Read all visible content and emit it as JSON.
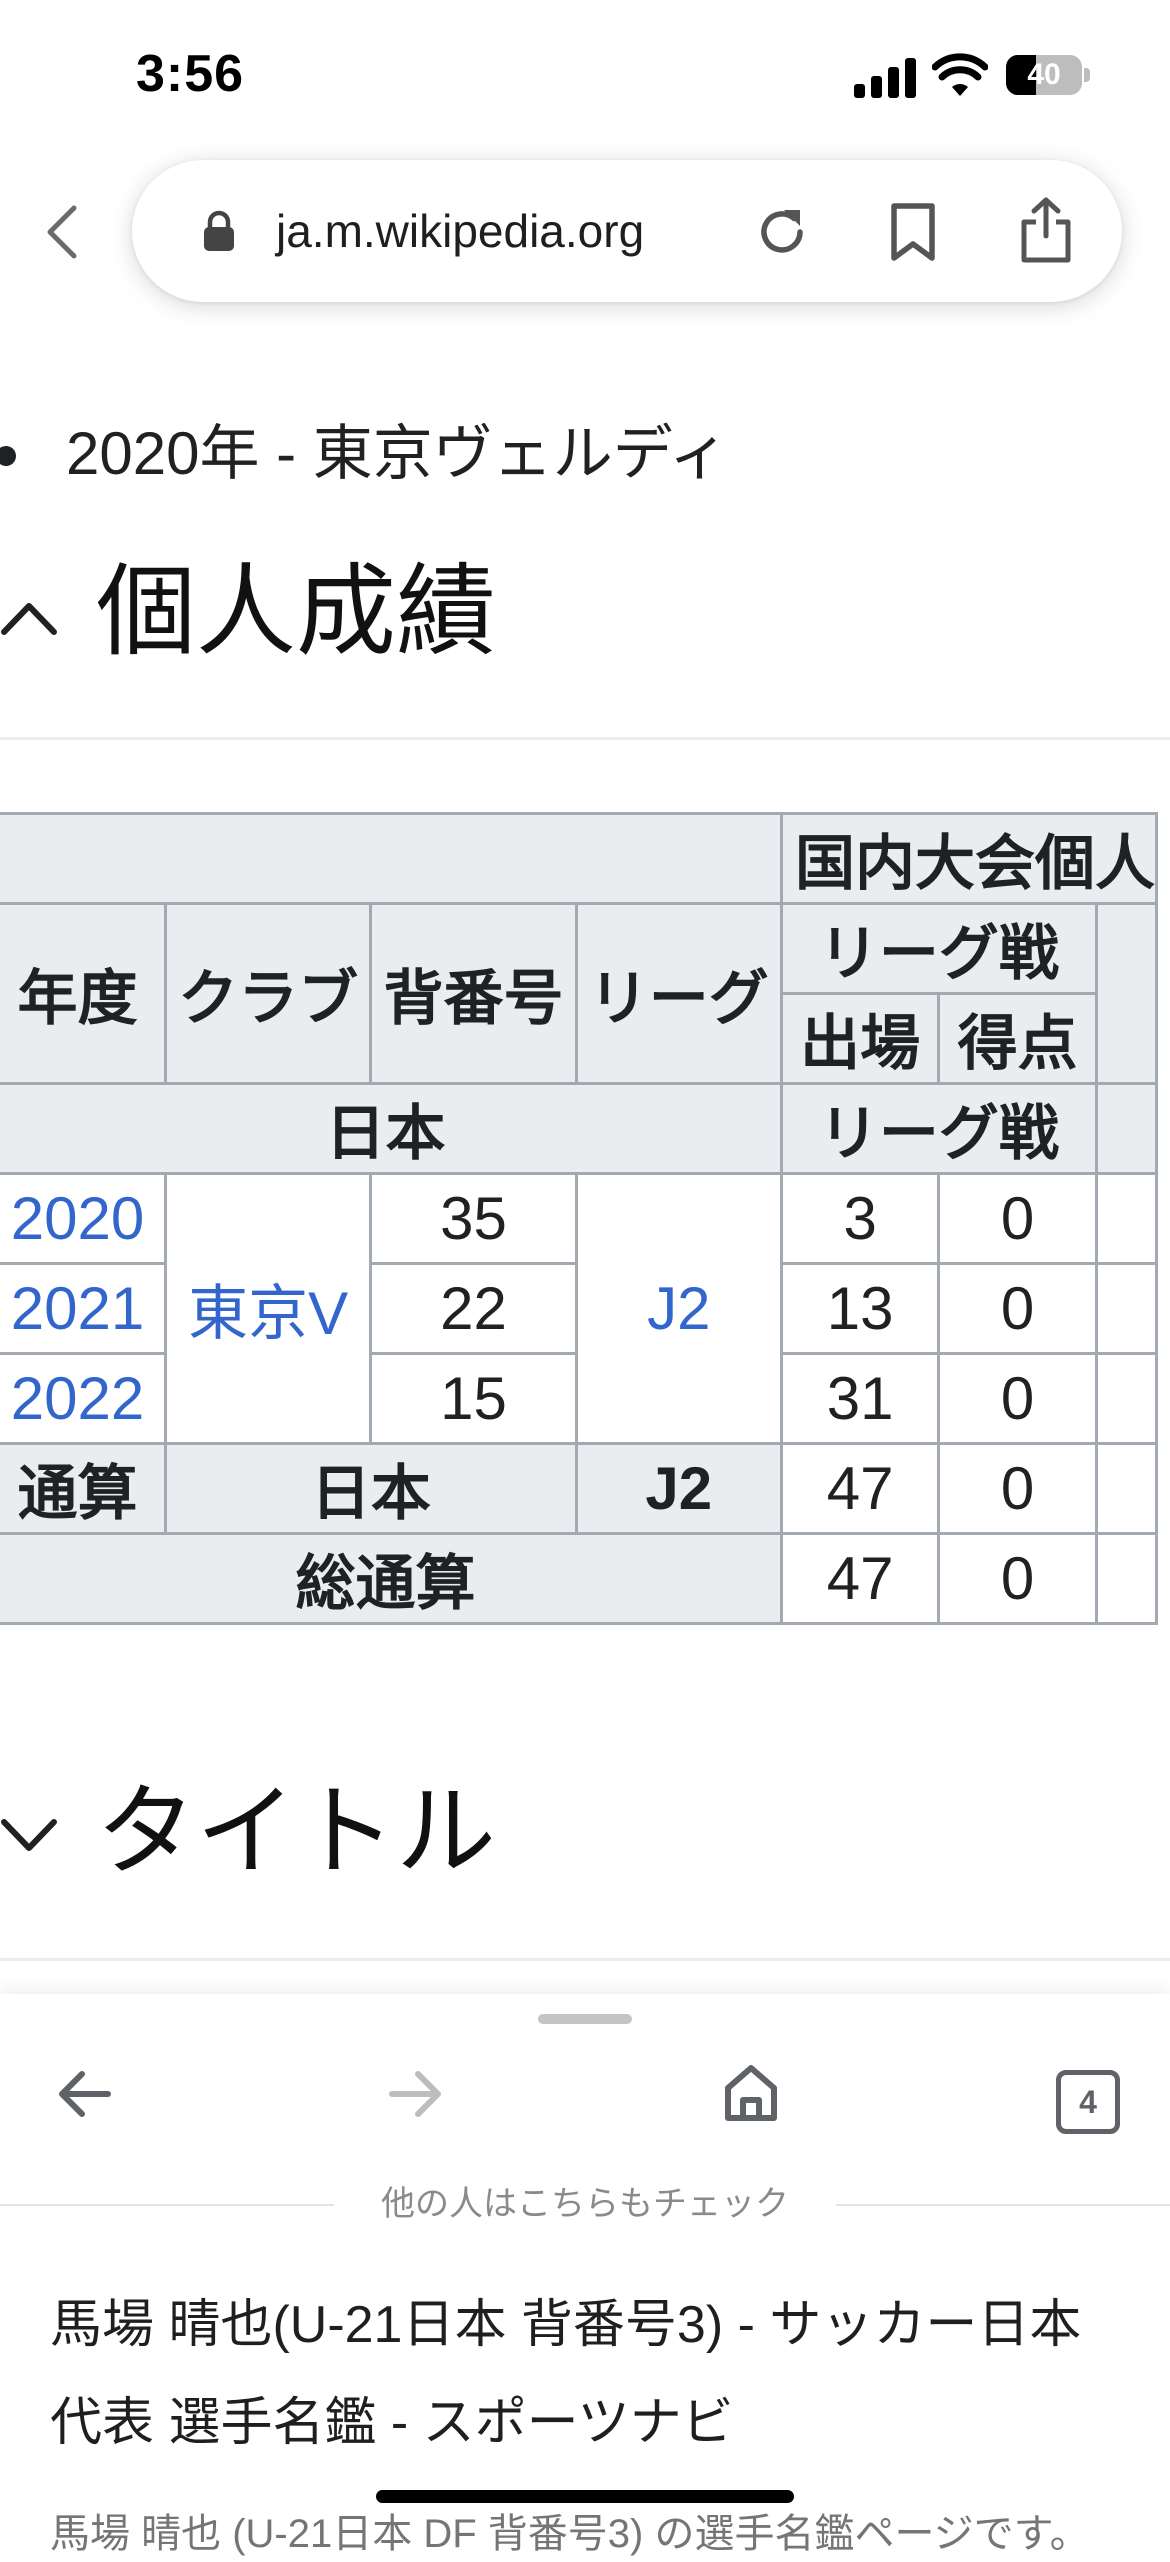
{
  "status_bar": {
    "time": "3:56",
    "battery": 40
  },
  "browser": {
    "url": "ja.m.wikipedia.org"
  },
  "article": {
    "bullet_item": "2020年 - 東京ヴェルディ",
    "section_stats": "個人成績",
    "section_titles": "タイトル"
  },
  "table": {
    "top_header": "国内大会個人",
    "headers": {
      "year": "年度",
      "club": "クラブ",
      "number": "背番号",
      "league": "リーグ",
      "league_group": "リーグ戦",
      "apps": "出場",
      "goals": "得点"
    },
    "country_row": {
      "country": "日本",
      "league_group": "リーグ戦"
    },
    "rows": [
      {
        "year": "2020",
        "number": "35",
        "apps": "3",
        "goals": "0"
      },
      {
        "year": "2021",
        "number": "22",
        "apps": "13",
        "goals": "0"
      },
      {
        "year": "2022",
        "number": "15",
        "apps": "31",
        "goals": "0"
      }
    ],
    "club": "東京V",
    "league": "J2",
    "total_row": {
      "label": "通算",
      "country": "日本",
      "league": "J2",
      "apps": "47",
      "goals": "0"
    },
    "grand_total_row": {
      "label": "総通算",
      "apps": "47",
      "goals": "0"
    }
  },
  "toolbar": {
    "tab_count": "4",
    "suggest_label": "他の人はこちらもチェック",
    "suggest_title": "馬場 晴也(U-21日本 背番号3) - サッカー日本代表 選手名鑑 - スポーツナビ",
    "suggest_snippet": "馬場 晴也 (U-21日本 DF 背番号3) の選手名鑑ページです。"
  },
  "colors": {
    "link": "#3366cc",
    "table_header_bg": "#eaecf0",
    "table_border": "#a2a9b1"
  }
}
